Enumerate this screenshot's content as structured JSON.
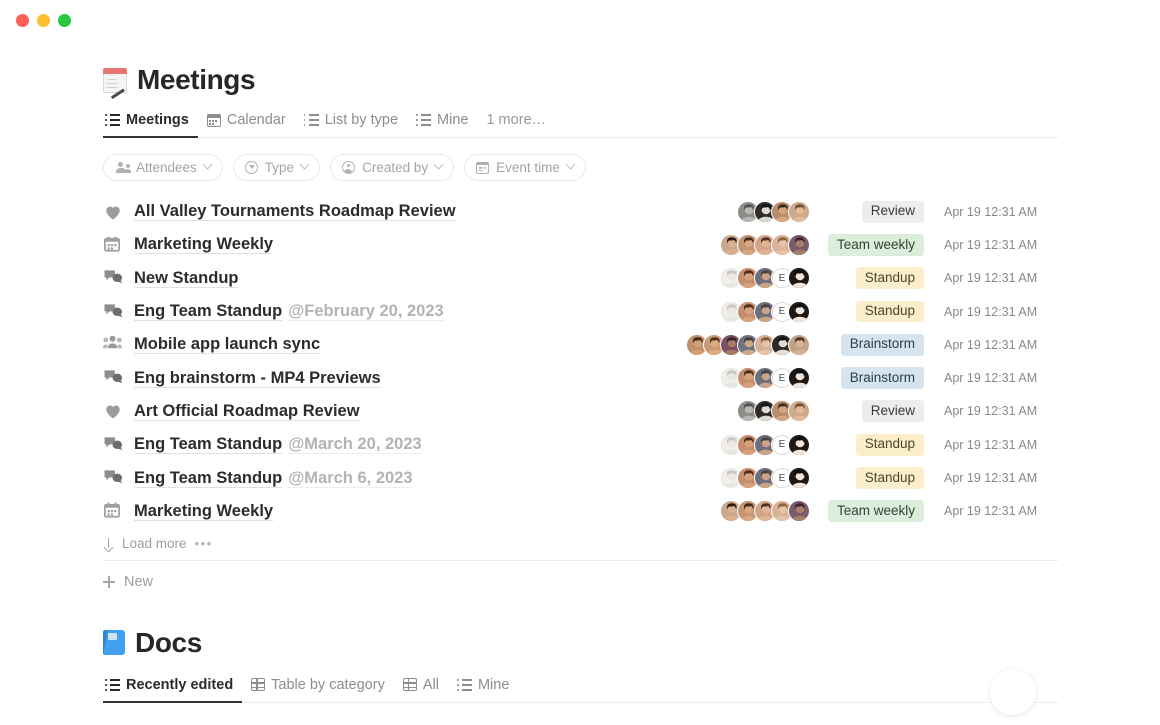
{
  "window": {
    "controls": [
      {
        "name": "close",
        "color": "#ff5f57"
      },
      {
        "name": "minimize",
        "color": "#febc2e"
      },
      {
        "name": "maximize",
        "color": "#28c840"
      }
    ]
  },
  "meetings": {
    "emoji": "memo-icon",
    "title": "Meetings",
    "tabs": [
      {
        "label": "Meetings",
        "icon": "list-icon",
        "active": true
      },
      {
        "label": "Calendar",
        "icon": "calendar-icon",
        "active": false
      },
      {
        "label": "List by type",
        "icon": "list-icon",
        "active": false
      },
      {
        "label": "Mine",
        "icon": "list-icon",
        "active": false
      },
      {
        "label": "1 more…",
        "icon": "none",
        "active": false
      }
    ],
    "filters": [
      {
        "label": "Attendees",
        "icon": "people-icon"
      },
      {
        "label": "Type",
        "icon": "circle-play-icon"
      },
      {
        "label": "Created by",
        "icon": "person-icon"
      },
      {
        "label": "Event time",
        "icon": "calendar-icon"
      }
    ],
    "rows": [
      {
        "icon": "heart-icon",
        "title": "All Valley Tournaments Roadmap Review",
        "sub": "",
        "avatars": 4,
        "avatar_style": "photo-a",
        "tag": "Review",
        "tag_color": "#eeedeb",
        "tag_text": "#3a3a38",
        "date": "Apr 19 12:31 AM"
      },
      {
        "icon": "calendar-icon",
        "title": "Marketing Weekly",
        "sub": "",
        "avatars": 5,
        "avatar_style": "photo-b",
        "tag": "Team weekly",
        "tag_color": "#dbeddb",
        "tag_text": "#2d482f",
        "date": "Apr 19 12:31 AM"
      },
      {
        "icon": "speech-icon",
        "title": "New Standup",
        "sub": "",
        "avatars": 5,
        "avatar_style": "photo-c",
        "tag": "Standup",
        "tag_color": "#fbeecb",
        "tag_text": "#50432a",
        "date": "Apr 19 12:31 AM"
      },
      {
        "icon": "speech-icon",
        "title": "Eng Team Standup",
        "sub": "@February 20, 2023",
        "avatars": 5,
        "avatar_style": "photo-c",
        "tag": "Standup",
        "tag_color": "#fbeecb",
        "tag_text": "#50432a",
        "date": "Apr 19 12:31 AM"
      },
      {
        "icon": "people-icon",
        "title": "Mobile app launch sync",
        "sub": "",
        "avatars": 7,
        "avatar_style": "photo-d",
        "tag": "Brainstorm",
        "tag_color": "#d6e4ef",
        "tag_text": "#28404f",
        "date": "Apr 19 12:31 AM"
      },
      {
        "icon": "speech-icon",
        "title": "Eng brainstorm - MP4 Previews",
        "sub": "",
        "avatars": 5,
        "avatar_style": "photo-c",
        "tag": "Brainstorm",
        "tag_color": "#d6e4ef",
        "tag_text": "#28404f",
        "date": "Apr 19 12:31 AM"
      },
      {
        "icon": "heart-icon",
        "title": "Art Official Roadmap Review",
        "sub": "",
        "avatars": 4,
        "avatar_style": "photo-a",
        "tag": "Review",
        "tag_color": "#eeedeb",
        "tag_text": "#3a3a38",
        "date": "Apr 19 12:31 AM"
      },
      {
        "icon": "speech-icon",
        "title": "Eng Team Standup",
        "sub": "@March 20, 2023",
        "avatars": 5,
        "avatar_style": "photo-c",
        "tag": "Standup",
        "tag_color": "#fbeecb",
        "tag_text": "#50432a",
        "date": "Apr 19 12:31 AM"
      },
      {
        "icon": "speech-icon",
        "title": "Eng Team Standup",
        "sub": "@March 6, 2023",
        "avatars": 5,
        "avatar_style": "photo-c",
        "tag": "Standup",
        "tag_color": "#fbeecb",
        "tag_text": "#50432a",
        "date": "Apr 19 12:31 AM"
      },
      {
        "icon": "calendar-icon",
        "title": "Marketing Weekly",
        "sub": "",
        "avatars": 5,
        "avatar_style": "photo-b",
        "tag": "Team weekly",
        "tag_color": "#dbeddb",
        "tag_text": "#2d482f",
        "date": "Apr 19 12:31 AM"
      }
    ],
    "load_more": "Load more",
    "load_more_dots": "•••",
    "new_label": "New"
  },
  "docs": {
    "emoji": "blue-book-icon",
    "title": "Docs",
    "tabs": [
      {
        "label": "Recently edited",
        "icon": "list-icon",
        "active": true
      },
      {
        "label": "Table by category",
        "icon": "table-icon",
        "active": false
      },
      {
        "label": "All",
        "icon": "table-icon",
        "active": false
      },
      {
        "label": "Mine",
        "icon": "list-icon",
        "active": false
      }
    ]
  }
}
